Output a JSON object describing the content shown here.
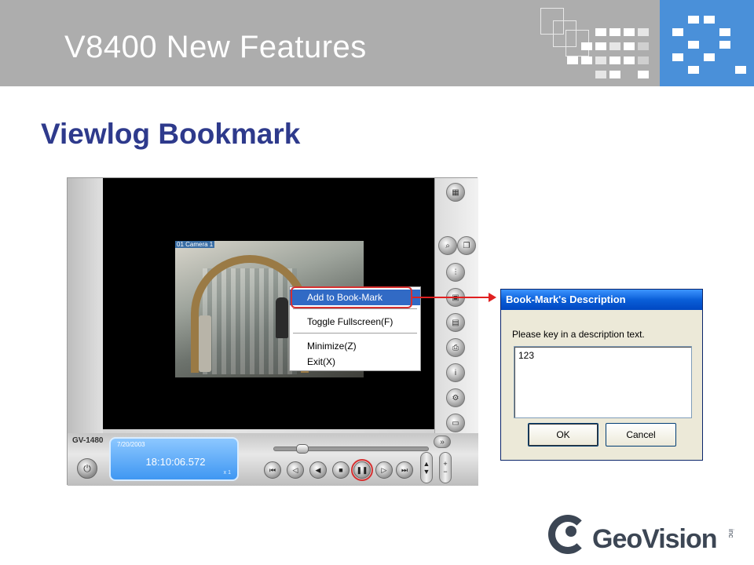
{
  "slide": {
    "title": "V8400 New Features",
    "subtitle": "Viewlog Bookmark"
  },
  "player": {
    "brand_label": "GV-1480",
    "camera_label": "01 Camera 1",
    "lcd": {
      "date": "7/20/2003",
      "time": "18:10:06.572",
      "speed": "x 1"
    },
    "playback_buttons": [
      "fast-rewind",
      "step-back",
      "play-reverse",
      "stop",
      "pause",
      "step-forward",
      "fast-forward"
    ],
    "active_button": "pause"
  },
  "context_menu": {
    "items": [
      {
        "label": "Add to Book-Mark",
        "highlighted": true
      },
      {
        "label": "Toggle Fullscreen(F)",
        "highlighted": false
      },
      {
        "label": "Minimize(Z)",
        "highlighted": false
      },
      {
        "label": "Exit(X)",
        "highlighted": false
      }
    ]
  },
  "dialog": {
    "title": "Book-Mark's Description",
    "prompt": "Please key in a description text.",
    "input_value": "123",
    "ok_label": "OK",
    "cancel_label": "Cancel"
  },
  "logo": {
    "name": "GeoVision",
    "suffix": "inc"
  },
  "colors": {
    "header_gray": "#adadad",
    "header_blue": "#4a90d9",
    "subtitle": "#2e3a8c",
    "highlight_red": "#d63030",
    "menu_highlight": "#316ac5",
    "xp_title_blue": "#0a5fd8"
  }
}
